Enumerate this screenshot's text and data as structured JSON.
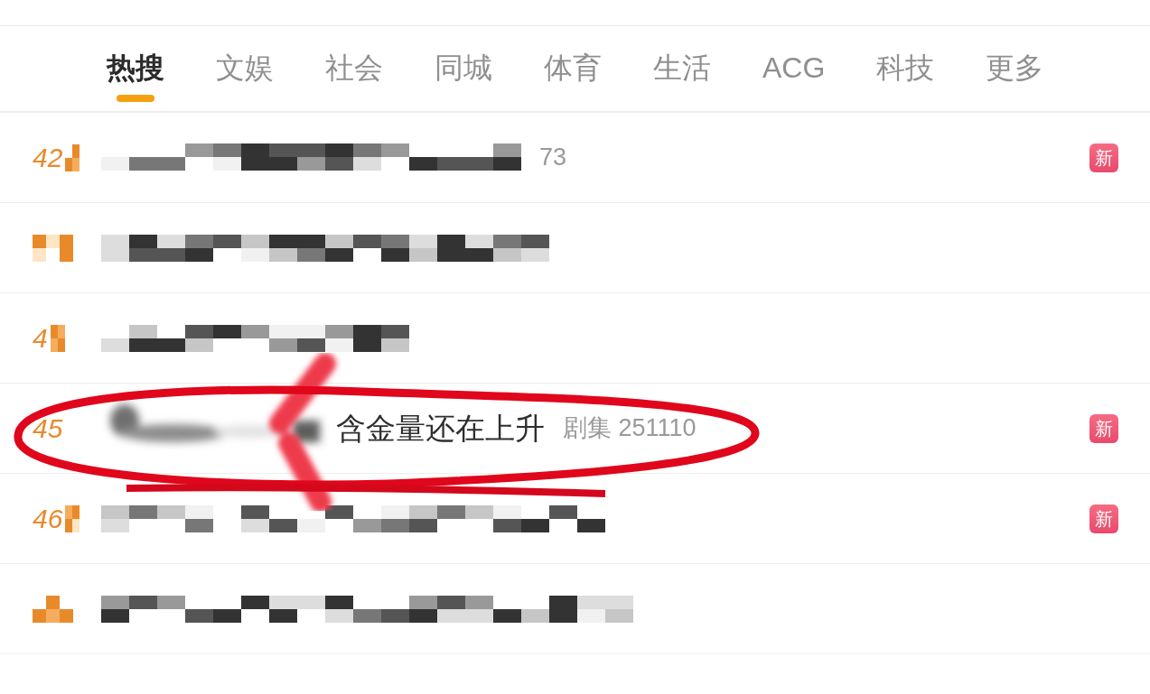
{
  "tabs": [
    {
      "label": "热搜",
      "selected": true
    },
    {
      "label": "文娱",
      "selected": false
    },
    {
      "label": "社会",
      "selected": false
    },
    {
      "label": "同城",
      "selected": false
    },
    {
      "label": "体育",
      "selected": false
    },
    {
      "label": "生活",
      "selected": false
    },
    {
      "label": "ACG",
      "selected": false
    },
    {
      "label": "科技",
      "selected": false
    },
    {
      "label": "更多",
      "selected": false
    }
  ],
  "rows": [
    {
      "rank": "42",
      "rank_pixelated": true,
      "kind": "mosaic",
      "meta": "73",
      "badge": "新",
      "circled": false
    },
    {
      "rank_pixelated": true,
      "kind": "mosaic",
      "circled": false
    },
    {
      "rank": "4",
      "rank_pixelated": true,
      "kind": "mosaic",
      "circled": false
    },
    {
      "rank": "45",
      "rank_pixelated": false,
      "kind": "blur",
      "title": "含金量还在上升",
      "meta": "剧集 251110",
      "badge": "新",
      "circled": true
    },
    {
      "rank": "46",
      "rank_pixelated": true,
      "kind": "mosaic",
      "badge": "新",
      "circled": false
    },
    {
      "rank_pixelated": true,
      "kind": "mosaic",
      "circled": false
    }
  ]
}
